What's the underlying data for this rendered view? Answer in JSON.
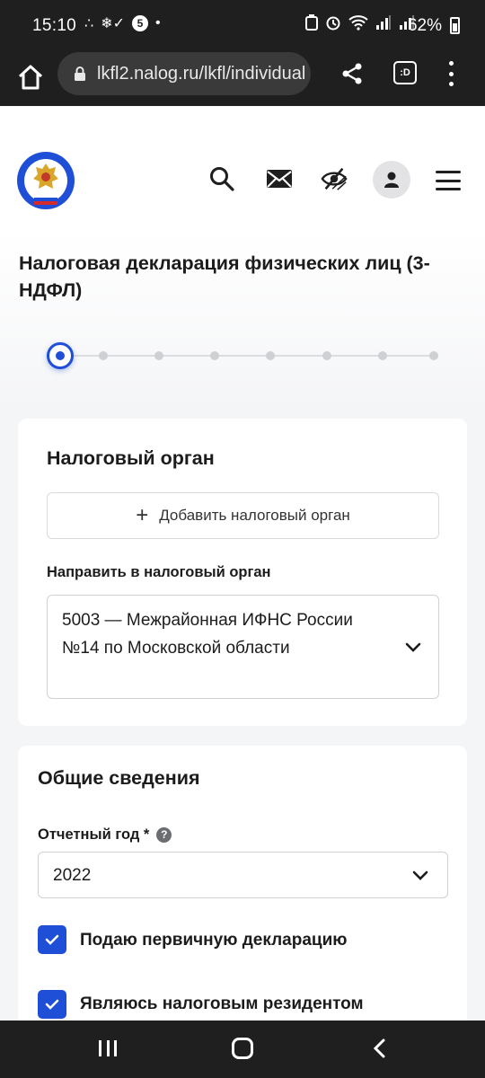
{
  "status_bar": {
    "time": "15:10",
    "left_icons": [
      "∴",
      "❄✓",
      "5",
      "•"
    ],
    "battery": "62%"
  },
  "browser": {
    "url": "lkfl2.nalog.ru/lkfl/individual",
    "tabs_icon_text": ":D"
  },
  "header": {
    "icons": [
      "logo-emblem",
      "search-icon",
      "mail-icon",
      "eye-crossed-icon",
      "user-icon",
      "menu-icon"
    ]
  },
  "page": {
    "title": "Налоговая декларация физических лиц (3-НДФЛ)",
    "stepper": {
      "current": 1,
      "total": 8
    }
  },
  "tax_authority": {
    "title": "Налоговый орган",
    "add_button": "Добавить налоговый орган",
    "send_label": "Направить в налоговый орган",
    "selected": "5003 — Межрайонная ИФНС России №14 по Московской области"
  },
  "general": {
    "title": "Общие сведения",
    "year_label": "Отчетный год *",
    "year_help": "?",
    "year_value": "2022",
    "checkbox_primary": "Подаю первичную декларацию",
    "checkbox_resident": "Являюсь налоговым резидентом"
  },
  "colors": {
    "accent": "#1e4fd6",
    "system_bar": "#1f1f1f",
    "page_bg": "#f4f5f7"
  }
}
